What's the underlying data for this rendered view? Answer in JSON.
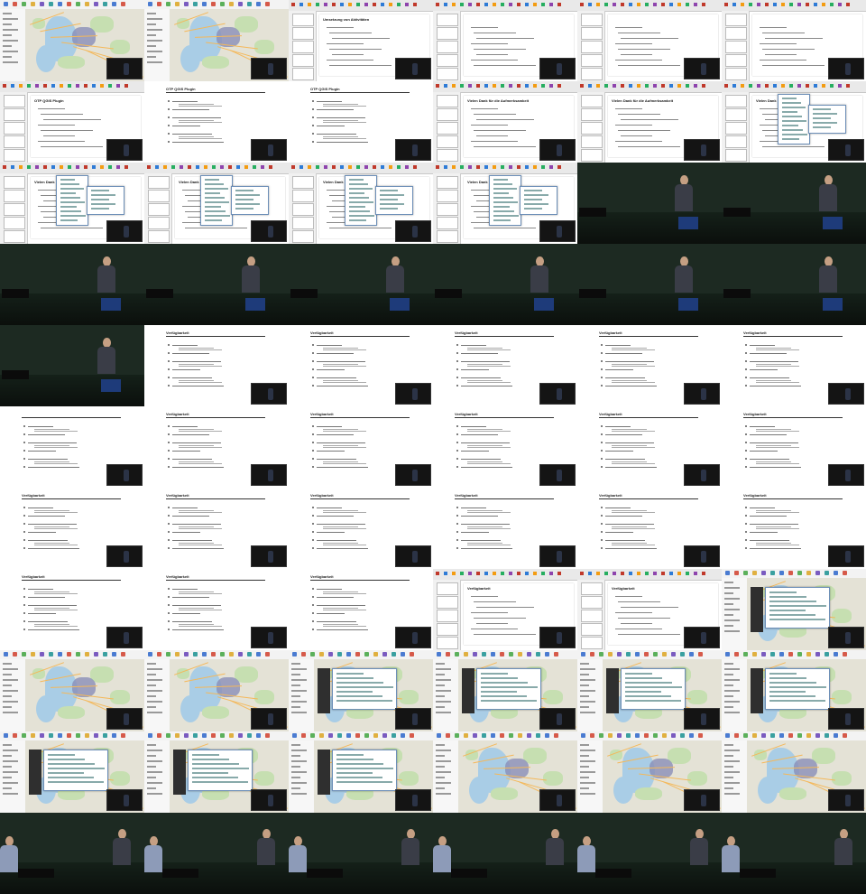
{
  "sheet": {
    "columns": 6,
    "rows": 11,
    "tile_count": 66
  },
  "tiles": [
    {
      "kind": "map"
    },
    {
      "kind": "map"
    },
    {
      "kind": "slide-ppt",
      "title": "Umsetzung von Aktivitäten"
    },
    {
      "kind": "slide-ppt",
      "title": ""
    },
    {
      "kind": "slide-ppt",
      "title": ""
    },
    {
      "kind": "slide-ppt",
      "title": ""
    },
    {
      "kind": "slide-ppt",
      "title": "OTP QGIS Plugin"
    },
    {
      "kind": "slide",
      "title": "OTP QGIS Plugin"
    },
    {
      "kind": "slide",
      "title": "OTP QGIS Plugin"
    },
    {
      "kind": "slide-ppt",
      "title": "Vielen Dank für die Aufmerksamkeit"
    },
    {
      "kind": "slide-ppt",
      "title": "Vielen Dank für die Aufmerksamkeit"
    },
    {
      "kind": "slide-ppt-dialog",
      "title": "Vielen Dank"
    },
    {
      "kind": "slide-ppt-dialog",
      "title": "Vielen Dank"
    },
    {
      "kind": "slide-ppt-dialog",
      "title": "Vielen Dank"
    },
    {
      "kind": "slide-ppt-dialog",
      "title": "Vielen Dank"
    },
    {
      "kind": "slide-ppt-dialog",
      "title": "Vielen Dank"
    },
    {
      "kind": "hall"
    },
    {
      "kind": "hall"
    },
    {
      "kind": "hall"
    },
    {
      "kind": "hall"
    },
    {
      "kind": "hall"
    },
    {
      "kind": "hall"
    },
    {
      "kind": "hall"
    },
    {
      "kind": "hall"
    },
    {
      "kind": "hall"
    },
    {
      "kind": "slide",
      "title": "Verfügbarkeit"
    },
    {
      "kind": "slide",
      "title": "Verfügbarkeit"
    },
    {
      "kind": "slide",
      "title": "Verfügbarkeit"
    },
    {
      "kind": "slide",
      "title": "Verfügbarkeit"
    },
    {
      "kind": "slide",
      "title": "Verfügbarkeit"
    },
    {
      "kind": "slide",
      "title": ""
    },
    {
      "kind": "slide",
      "title": "Verfügbarkeit"
    },
    {
      "kind": "slide",
      "title": "Verfügbarkeit"
    },
    {
      "kind": "slide",
      "title": "Verfügbarkeit"
    },
    {
      "kind": "slide",
      "title": "Verfügbarkeit"
    },
    {
      "kind": "slide",
      "title": "Verfügbarkeit"
    },
    {
      "kind": "slide",
      "title": "Verfügbarkeit"
    },
    {
      "kind": "slide",
      "title": "Verfügbarkeit"
    },
    {
      "kind": "slide",
      "title": "Verfügbarkeit"
    },
    {
      "kind": "slide",
      "title": "Verfügbarkeit"
    },
    {
      "kind": "slide",
      "title": "Verfügbarkeit"
    },
    {
      "kind": "slide",
      "title": "Verfügbarkeit"
    },
    {
      "kind": "slide",
      "title": "Verfügbarkeit"
    },
    {
      "kind": "slide",
      "title": "Verfügbarkeit"
    },
    {
      "kind": "slide",
      "title": "Verfügbarkeit"
    },
    {
      "kind": "slide-ppt",
      "title": "Verfügbarkeit"
    },
    {
      "kind": "slide-ppt",
      "title": "Verfügbarkeit"
    },
    {
      "kind": "map-dialog"
    },
    {
      "kind": "map"
    },
    {
      "kind": "map"
    },
    {
      "kind": "map-dialog"
    },
    {
      "kind": "map-dialog"
    },
    {
      "kind": "map-dialog"
    },
    {
      "kind": "map-dialog"
    },
    {
      "kind": "map-dialog"
    },
    {
      "kind": "map-dialog"
    },
    {
      "kind": "map-dialog"
    },
    {
      "kind": "map"
    },
    {
      "kind": "map"
    },
    {
      "kind": "map"
    },
    {
      "kind": "hall2"
    },
    {
      "kind": "hall2"
    },
    {
      "kind": "hall2"
    },
    {
      "kind": "hall2"
    },
    {
      "kind": "hall2"
    },
    {
      "kind": "hall2"
    }
  ],
  "colors": {
    "podium": "#1e3b7a",
    "map_water": "#a9cde6",
    "map_city": "#8a8fb8"
  }
}
